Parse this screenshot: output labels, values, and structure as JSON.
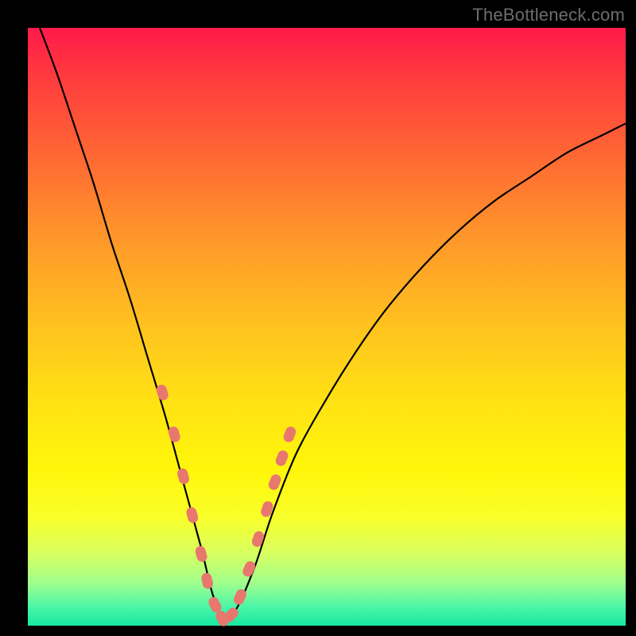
{
  "watermark": "TheBottleneck.com",
  "colors": {
    "frame": "#000000",
    "curve": "#000000",
    "dot": "#e8776e"
  },
  "chart_data": {
    "type": "line",
    "title": "",
    "xlabel": "",
    "ylabel": "",
    "xlim": [
      0,
      100
    ],
    "ylim": [
      0,
      100
    ],
    "grid": false,
    "note": "Axes are unlabeled in the source image; x and y are normalized 0–100. The curve is a V-shaped bottleneck profile reaching ~0 near x≈33 and rising toward both edges.",
    "series": [
      {
        "name": "bottleneck-curve",
        "x": [
          2,
          5,
          8,
          11,
          14,
          17,
          20,
          23,
          26,
          29,
          31,
          33,
          35,
          38,
          41,
          45,
          50,
          55,
          60,
          66,
          72,
          78,
          84,
          90,
          96,
          100
        ],
        "y": [
          100,
          92,
          83,
          74,
          64,
          55,
          45,
          35,
          24,
          13,
          5,
          1,
          3,
          10,
          19,
          29,
          38,
          46,
          53,
          60,
          66,
          71,
          75,
          79,
          82,
          84
        ]
      }
    ],
    "markers": {
      "name": "highlighted-points",
      "note": "Salmon capsule markers clustered near the trough on both arms of the V.",
      "x": [
        22.5,
        24.5,
        26.0,
        27.5,
        29.0,
        30.0,
        31.3,
        32.5,
        34.0,
        35.5,
        37.0,
        38.5,
        40.0,
        41.3,
        42.5,
        43.8
      ],
      "y": [
        39.0,
        32.0,
        25.0,
        18.5,
        12.0,
        7.5,
        3.5,
        1.2,
        1.8,
        4.8,
        9.5,
        14.5,
        19.5,
        24.0,
        28.0,
        32.0
      ]
    }
  }
}
